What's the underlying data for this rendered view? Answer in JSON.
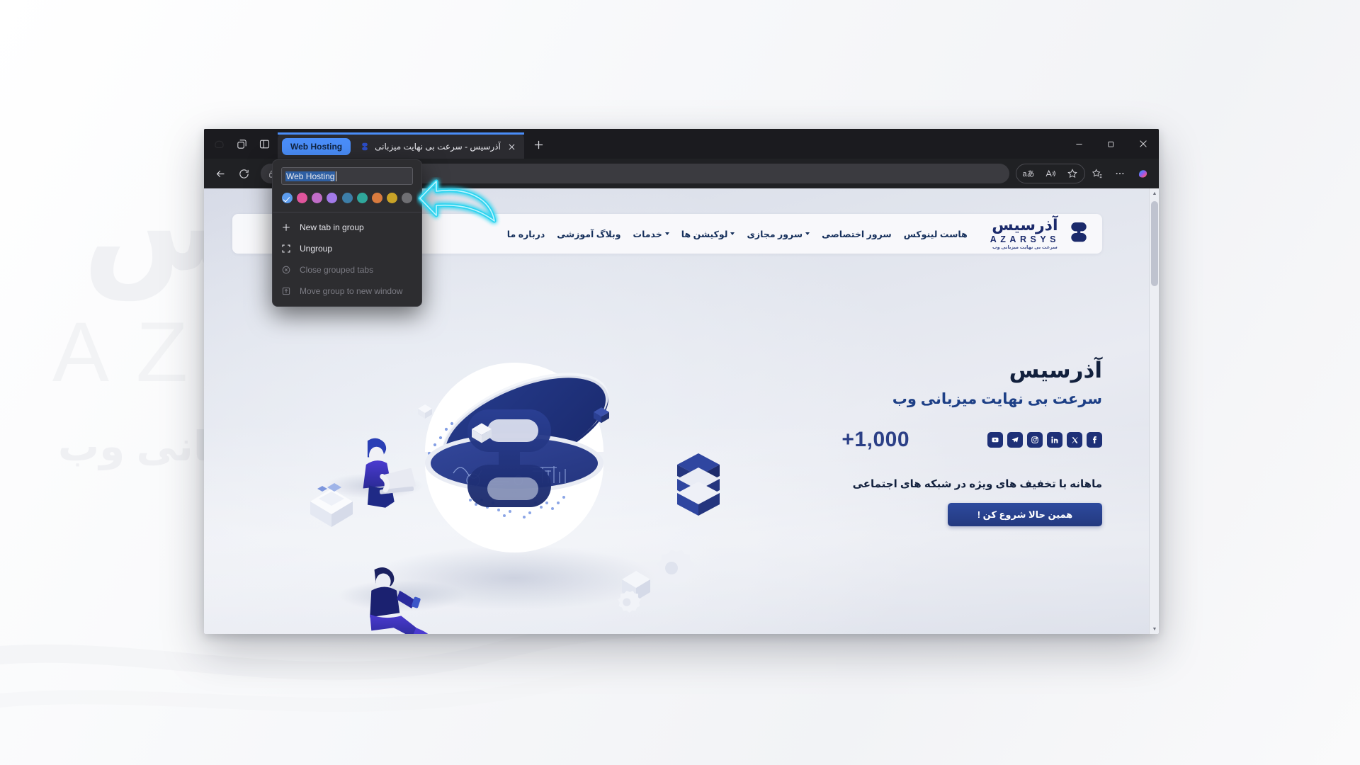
{
  "watermark": {
    "fa_title": "آذرسیس",
    "en_title": "AZARSYS",
    "tagline": "سرعت بی نهایت میزبانی وب"
  },
  "browser": {
    "name": "Microsoft Edge",
    "window_controls": {
      "minimize": "Minimize",
      "maximize": "Restore",
      "close": "Close"
    },
    "tabstrip": {
      "copilot_label": "Copilot",
      "tab_actions_label": "Tab actions menu",
      "split_screen_label": "Split screen",
      "new_tab_label": "New tab",
      "group_chip_label": "Web Hosting",
      "tabs": [
        {
          "title": "آذرسیس - سرعت بی نهایت میزبانی",
          "favicon": "azarsys-s-icon",
          "active": true,
          "close_label": "Close tab"
        }
      ]
    },
    "toolbar": {
      "back_label": "Back",
      "refresh_label": "Refresh",
      "lock_label": "View site information",
      "url": "",
      "translate_label": "aあ",
      "read_aloud_label": "Read aloud",
      "favorite_label": "Add this page to favorites",
      "collections_label": "Collections",
      "settings_label": "Settings and more",
      "copilot_label": "Copilot"
    }
  },
  "group_popup": {
    "name_value": "Web Hosting",
    "name_placeholder": "Name this group",
    "colors": [
      {
        "name": "blue",
        "hex": "#5c9ced",
        "selected": true
      },
      {
        "name": "pink",
        "hex": "#e0559c"
      },
      {
        "name": "orchid",
        "hex": "#c16dc8"
      },
      {
        "name": "purple",
        "hex": "#a27ae8"
      },
      {
        "name": "steel-blue",
        "hex": "#3d7ea8"
      },
      {
        "name": "teal",
        "hex": "#2fa79b"
      },
      {
        "name": "orange",
        "hex": "#d97b3e"
      },
      {
        "name": "gold",
        "hex": "#c9a327"
      },
      {
        "name": "grey",
        "hex": "#6f6f73"
      }
    ],
    "items": [
      {
        "label": "New tab in group",
        "icon": "plus-icon",
        "disabled": false
      },
      {
        "label": "Ungroup",
        "icon": "ungroup-icon",
        "disabled": false
      },
      {
        "label": "Close grouped tabs",
        "icon": "close-circle-icon",
        "disabled": true
      },
      {
        "label": "Move group to new window",
        "icon": "move-window-icon",
        "disabled": true
      }
    ]
  },
  "site": {
    "logo": {
      "fa": "آذرسیس",
      "en": "AZARSYS",
      "tagline": "سرعت بی نهایت میزبانی وب"
    },
    "nav": [
      {
        "label": "هاست لینوکس",
        "has_caret": false
      },
      {
        "label": "سرور اختصاصی",
        "has_caret": false
      },
      {
        "label": "سرور مجازی",
        "has_caret": true
      },
      {
        "label": "لوکیشن ها",
        "has_caret": true
      },
      {
        "label": "خدمات",
        "has_caret": true
      },
      {
        "label": "وبلاگ آموزشی",
        "has_caret": false
      },
      {
        "label": "درباره ما",
        "has_caret": false
      }
    ],
    "hero": {
      "title": "آذرسیس",
      "subtitle": "سرعت بی نهایت میزبانی وب",
      "count": "+1,000",
      "socials": [
        {
          "name": "youtube-icon"
        },
        {
          "name": "telegram-icon"
        },
        {
          "name": "instagram-icon"
        },
        {
          "name": "linkedin-icon"
        },
        {
          "name": "x-icon"
        },
        {
          "name": "facebook-icon"
        }
      ],
      "promo": "ماهانه با تخفیف های ویژه در شبکه های اجتماعی",
      "cta": "همین حالا شروع کن !"
    }
  },
  "colors": {
    "brand_blue": "#1e3077",
    "accent_blue": "#2d4a9e",
    "group_blue": "#4a8df8",
    "annotation_cyan": "#2ed4f0"
  }
}
